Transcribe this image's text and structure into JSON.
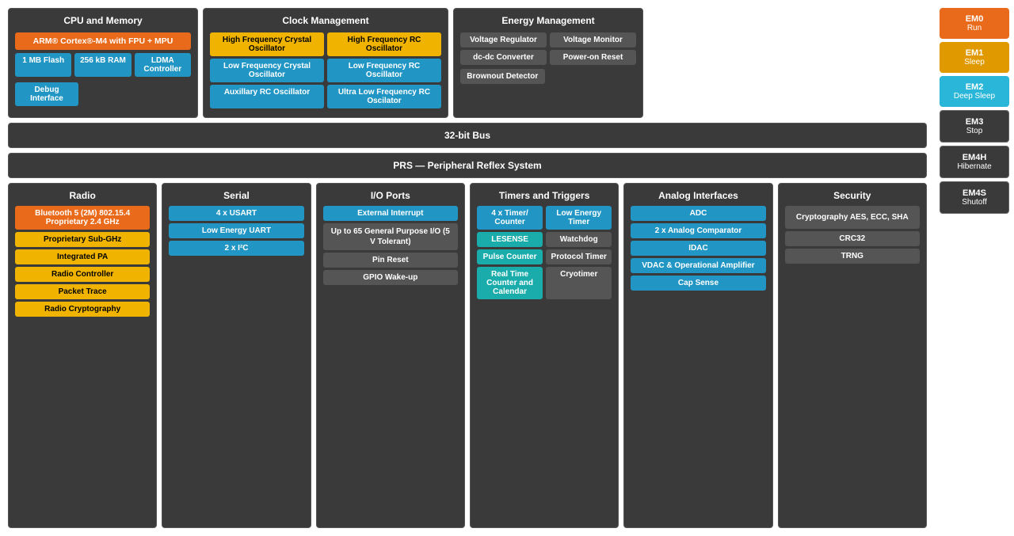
{
  "header": {
    "cpu_title": "CPU and Memory",
    "clock_title": "Clock Management",
    "energy_title": "Energy Management"
  },
  "cpu": {
    "arm": "ARM® Cortex®-M4 with FPU + MPU",
    "flash": "1 MB Flash",
    "ram": "256 kB RAM",
    "ldma": "LDMA Controller",
    "debug": "Debug Interface"
  },
  "clock": {
    "hfxo": "High Frequency Crystal Oscillator",
    "hfrco": "High Frequency RC Oscillator",
    "lfxo": "Low Frequency Crystal Oscillator",
    "lfrco": "Low Frequency RC Oscillator",
    "auxrc": "Auxillary RC Oscillator",
    "ulfrco": "Ultra Low Frequency RC Oscilator"
  },
  "energy": {
    "vreg": "Voltage Regulator",
    "vmon": "Voltage Monitor",
    "dcdc": "dc-dc Converter",
    "por": "Power-on Reset",
    "bod": "Brownout Detector"
  },
  "bus": "32-bit Bus",
  "prs": "PRS — Peripheral Reflex System",
  "radio": {
    "title": "Radio",
    "bt": "Bluetooth 5 (2M) 802.15.4 Proprietary 2.4 GHz",
    "sub": "Proprietary Sub-GHz",
    "pa": "Integrated PA",
    "ctrl": "Radio Controller",
    "trace": "Packet Trace",
    "crypto": "Radio Cryptography"
  },
  "serial": {
    "title": "Serial",
    "usart": "4 x USART",
    "leuart": "Low Energy UART",
    "i2c": "2 x I²C"
  },
  "io": {
    "title": "I/O Ports",
    "ext": "External Interrupt",
    "gpio": "Up to 65 General Purpose I/O (5 V Tolerant)",
    "pin": "Pin Reset",
    "wake": "GPIO Wake-up"
  },
  "timers": {
    "title": "Timers and Triggers",
    "timer": "4 x Timer/ Counter",
    "letimer": "Low Energy Timer",
    "lesense": "LESENSE",
    "watchdog": "Watchdog",
    "pulse": "Pulse Counter",
    "proto": "Protocol Timer",
    "rtc": "Real Time Counter and Calendar",
    "cryo": "Cryotimer"
  },
  "analog": {
    "title": "Analog Interfaces",
    "adc": "ADC",
    "comp": "2 x Analog Comparator",
    "idac": "IDAC",
    "vdac": "VDAC & Operational Amplifier",
    "cap": "Cap Sense"
  },
  "security": {
    "title": "Security",
    "crypto": "Cryptography AES, ECC, SHA",
    "crc": "CRC32",
    "trng": "TRNG"
  },
  "sidebar": {
    "em0_label": "EM0",
    "em0_sub": "Run",
    "em1_label": "EM1",
    "em1_sub": "Sleep",
    "em2_label": "EM2",
    "em2_sub": "Deep Sleep",
    "em3_label": "EM3",
    "em3_sub": "Stop",
    "em4h_label": "EM4H",
    "em4h_sub": "Hibernate",
    "em4s_label": "EM4S",
    "em4s_sub": "Shutoff"
  }
}
